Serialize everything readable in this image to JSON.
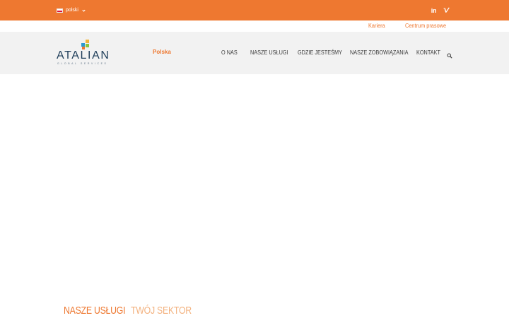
{
  "colors": {
    "brand": "#ee7830",
    "logo_text": "#1f3e5a",
    "header_bg": "#f2f2f2"
  },
  "topbar": {
    "language": {
      "flag": "poland-flag",
      "label": "polski",
      "chevron": "chevron-down-icon"
    },
    "social": [
      {
        "name": "linkedin",
        "glyph": "in"
      },
      {
        "name": "vimeo",
        "glyph": "vimeo-icon"
      }
    ]
  },
  "utility": {
    "career": "Kariera",
    "press": "Centrum prasowe"
  },
  "header": {
    "logo": {
      "word": "ATALIAN",
      "tagline": "GLOBAL SERVICES"
    },
    "region": "Polska",
    "nav": [
      "O NAS",
      "NASZE USŁUGI",
      "GDZIE JESTEŚMY",
      "NASZE ZOBOWIĄZANIA",
      "KONTAKT"
    ],
    "search_icon": "search-icon"
  },
  "sections": {
    "tabs": [
      {
        "label": "NASZE USŁUGI",
        "active": true
      },
      {
        "label": "TWÓJ SEKTOR",
        "active": false
      }
    ]
  }
}
